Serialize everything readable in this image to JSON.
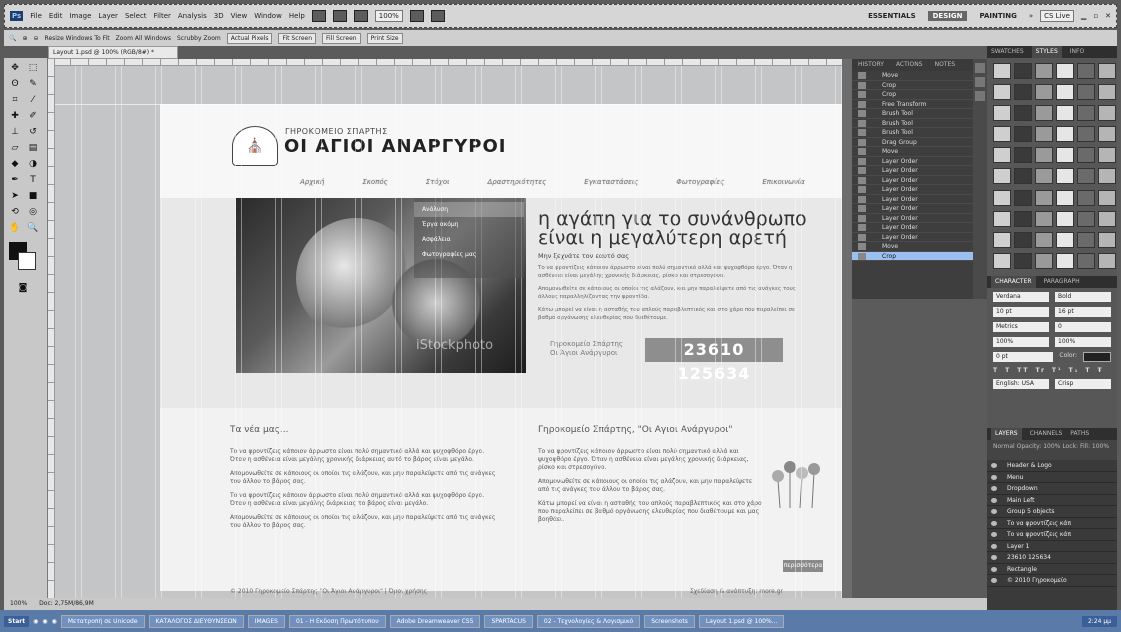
{
  "menubar": {
    "logo": "Ps",
    "items": [
      "File",
      "Edit",
      "Image",
      "Layer",
      "Select",
      "Filter",
      "Analysis",
      "3D",
      "View",
      "Window",
      "Help"
    ],
    "zoom": "100%",
    "workspaces": [
      "ESSENTIALS",
      "DESIGN",
      "PAINTING"
    ],
    "active_workspace": "DESIGN",
    "overflow": "»",
    "cslive": "CS Live"
  },
  "options": {
    "checkbox1": "Resize Windows To Fit",
    "checkbox2": "Zoom All Windows",
    "checkbox3": "Scrubby Zoom",
    "buttons": [
      "Actual Pixels",
      "Fit Screen",
      "Fill Screen",
      "Print Size"
    ]
  },
  "document": {
    "tab_title": "Layout 1.psd @ 100% (RGB/8#) *"
  },
  "site": {
    "logo_subtitle": "ΓΗΡΟΚΟΜΕΙΟ ΣΠΑΡΤΗΣ",
    "logo_title": "ΟΙ ΑΓΙΟΙ ΑΝΑΡΓΥΡΟΙ",
    "nav": [
      "Αρχική",
      "Σκοπός",
      "Στόχοι",
      "Δραστηριότητες",
      "Εγκαταστάσεις",
      "Φωτογραφίες",
      "Επικοινωνία"
    ],
    "dropdown": [
      "Ανάλυση",
      "Έργα ακόμη",
      "Ασφάλεια",
      "Φωτογραφίες μας"
    ],
    "watermark": "iStockphoto",
    "hero_title": "η αγάπη για το συνάνθρωπο είναι η μεγαλύτερη αρετή",
    "hero_lead": "Μην ξεχνάτε τον εαυτό σας",
    "hero_text": [
      "Το να φροντίζεις κάποιον άρρωστο είναι πολύ σημαντικό αλλά και ψυχοφθόρο έργο. Όταν η ασθένεια είναι μεγάλης χρονικής διάρκειας, ρίσκο και στρεσογόνο.",
      "Απομονωθείτε σε κάποιους οι οποίοι τις αλάζουν, και μην παραλείψετε από τις ανάγκες τους άλλους παραλληλίζοντας την φροντίδα.",
      "Κάτω μπορεί να είναι η ασταθής του απλούς παραβλεπτικός και στο χάρο που παραλείπει σε βαθμό οργάνωσης ελευθερίας που διαθέτουμε."
    ],
    "phone_label_1": "Γηροκομείο Σπάρτης",
    "phone_label_2": "Οι Άγιοι Ανάργυροι",
    "phone": "23610 125634",
    "news_title": "Τα νέα μας...",
    "news_paragraphs": [
      "Το να φροντίζεις κάποιον άρρωστο είναι πολύ σημαντικό αλλά και ψυχοφθόρο έργο. Όταν η ασθένεια είναι μεγάλης χρονικής διάρκειας αυτό το βάρος είναι μεγάλο.",
      "Απομονωθείτε σε κάποιους οι οποίοι τις αλάζουν, και μην παραλείψετε από τις ανάγκες του άλλου το βάρος σας.",
      "Το να φροντίζεις κάποιον άρρωστο είναι πολύ σημαντικό αλλά και ψυχοφθόρο έργο. Όταν η ασθένεια είναι μεγάλης διάρκειας το βάρος είναι μεγάλο.",
      "Απομονωθείτε σε κάποιους οι οποίοι τις αλάζουν, και μην παραλείψετε από τις ανάγκες του άλλου το βάρος σας."
    ],
    "about_title": "Γηροκομείο Σπάρτης, \"Οι Αγιοι Ανάργυροι\"",
    "about_paragraphs": [
      "Το να φροντίζεις κάποιον άρρωστο είναι πολύ σημαντικό αλλά και ψυχοφθόρο έργο. Όταν η ασθένεια είναι μεγάλης χρονικής διάρκειας, ρίσκο και στρεσογόνο.",
      "Απομονωθείτε σε κάποιους οι οποίοι τις αλάζουν, και μην παραλείψετε από τις ανάγκες του άλλου το βάρος σας.",
      "Κάτω μπορεί να είναι η ασταθής του απλούς παραβλεπτικός και στο χάρο που παραλείπει σε βαθμό οργάνωσης ελευθερίας που διαθέτουμε και μας βοηθάει."
    ],
    "more_button": "περισσότερα",
    "footer_left": "© 2010 Γηροκομείο Σπάρτης \"Οι Άγιοι Ανάργυροι\"  |  Όροι χρήσης",
    "footer_right": "Σχεδίαση & ανάπτυξη: more.gr"
  },
  "history": {
    "tabs": [
      "HISTORY",
      "ACTIONS",
      "NOTES"
    ],
    "items": [
      "Move",
      "Crop",
      "Crop",
      "Free Transform",
      "Brush Tool",
      "Brush Tool",
      "Brush Tool",
      "Drag Group",
      "Move",
      "Layer Order",
      "Layer Order",
      "Layer Order",
      "Layer Order",
      "Layer Order",
      "Layer Order",
      "Layer Order",
      "Layer Order",
      "Layer Order",
      "Move",
      "Crop"
    ],
    "selected_index": 19
  },
  "swatches": {
    "tabs": [
      "SWATCHES",
      "STYLES",
      "INFO"
    ]
  },
  "character": {
    "tabs": [
      "CHARACTER",
      "PARAGRAPH"
    ],
    "font": "Verdana",
    "style": "Bold",
    "size": "10 pt",
    "leading": "16 pt",
    "kerning": "Metrics",
    "tracking": "0",
    "vscale": "100%",
    "hscale": "100%",
    "baseline": "0 pt",
    "color_label": "Color:",
    "language": "English: USA",
    "antialias": "Crisp"
  },
  "layers": {
    "tabs": [
      "LAYERS",
      "CHANNELS",
      "PATHS"
    ],
    "blend": "Normal",
    "opacity_label": "Opacity:",
    "opacity": "100%",
    "lock_label": "Lock:",
    "fill_label": "Fill:",
    "fill": "100%",
    "items": [
      "Header & Logo",
      "Menu",
      "Dropdown",
      "Main Left",
      "Group 5 objects",
      "Το να φροντίζεις κάπ",
      "Το να φροντίζεις κάπ",
      "Layer 1",
      "23610 125634",
      "Rectangle",
      "© 2010 Γηροκομείο"
    ]
  },
  "status": {
    "zoom": "100%",
    "doc": "Doc: 2,75M/86,9M"
  },
  "taskbar": {
    "start": "Start",
    "tasks": [
      "Μετατροπή σε Unicode",
      "ΚΑΤΑΛΟΓΟΣ ΔΙΕΥΘΥΝΣΕΩΝ",
      "IMAGES",
      "01 - Η Εκδοση Πρωτότυπου",
      "Adobe Dreamweaver CS5",
      "SPARTACUS",
      "02 - Τεχνολογίες & Λογισμικό",
      "Screenshots",
      "Layout 1.psd @ 100%..."
    ],
    "clock": "2:24 μμ"
  }
}
